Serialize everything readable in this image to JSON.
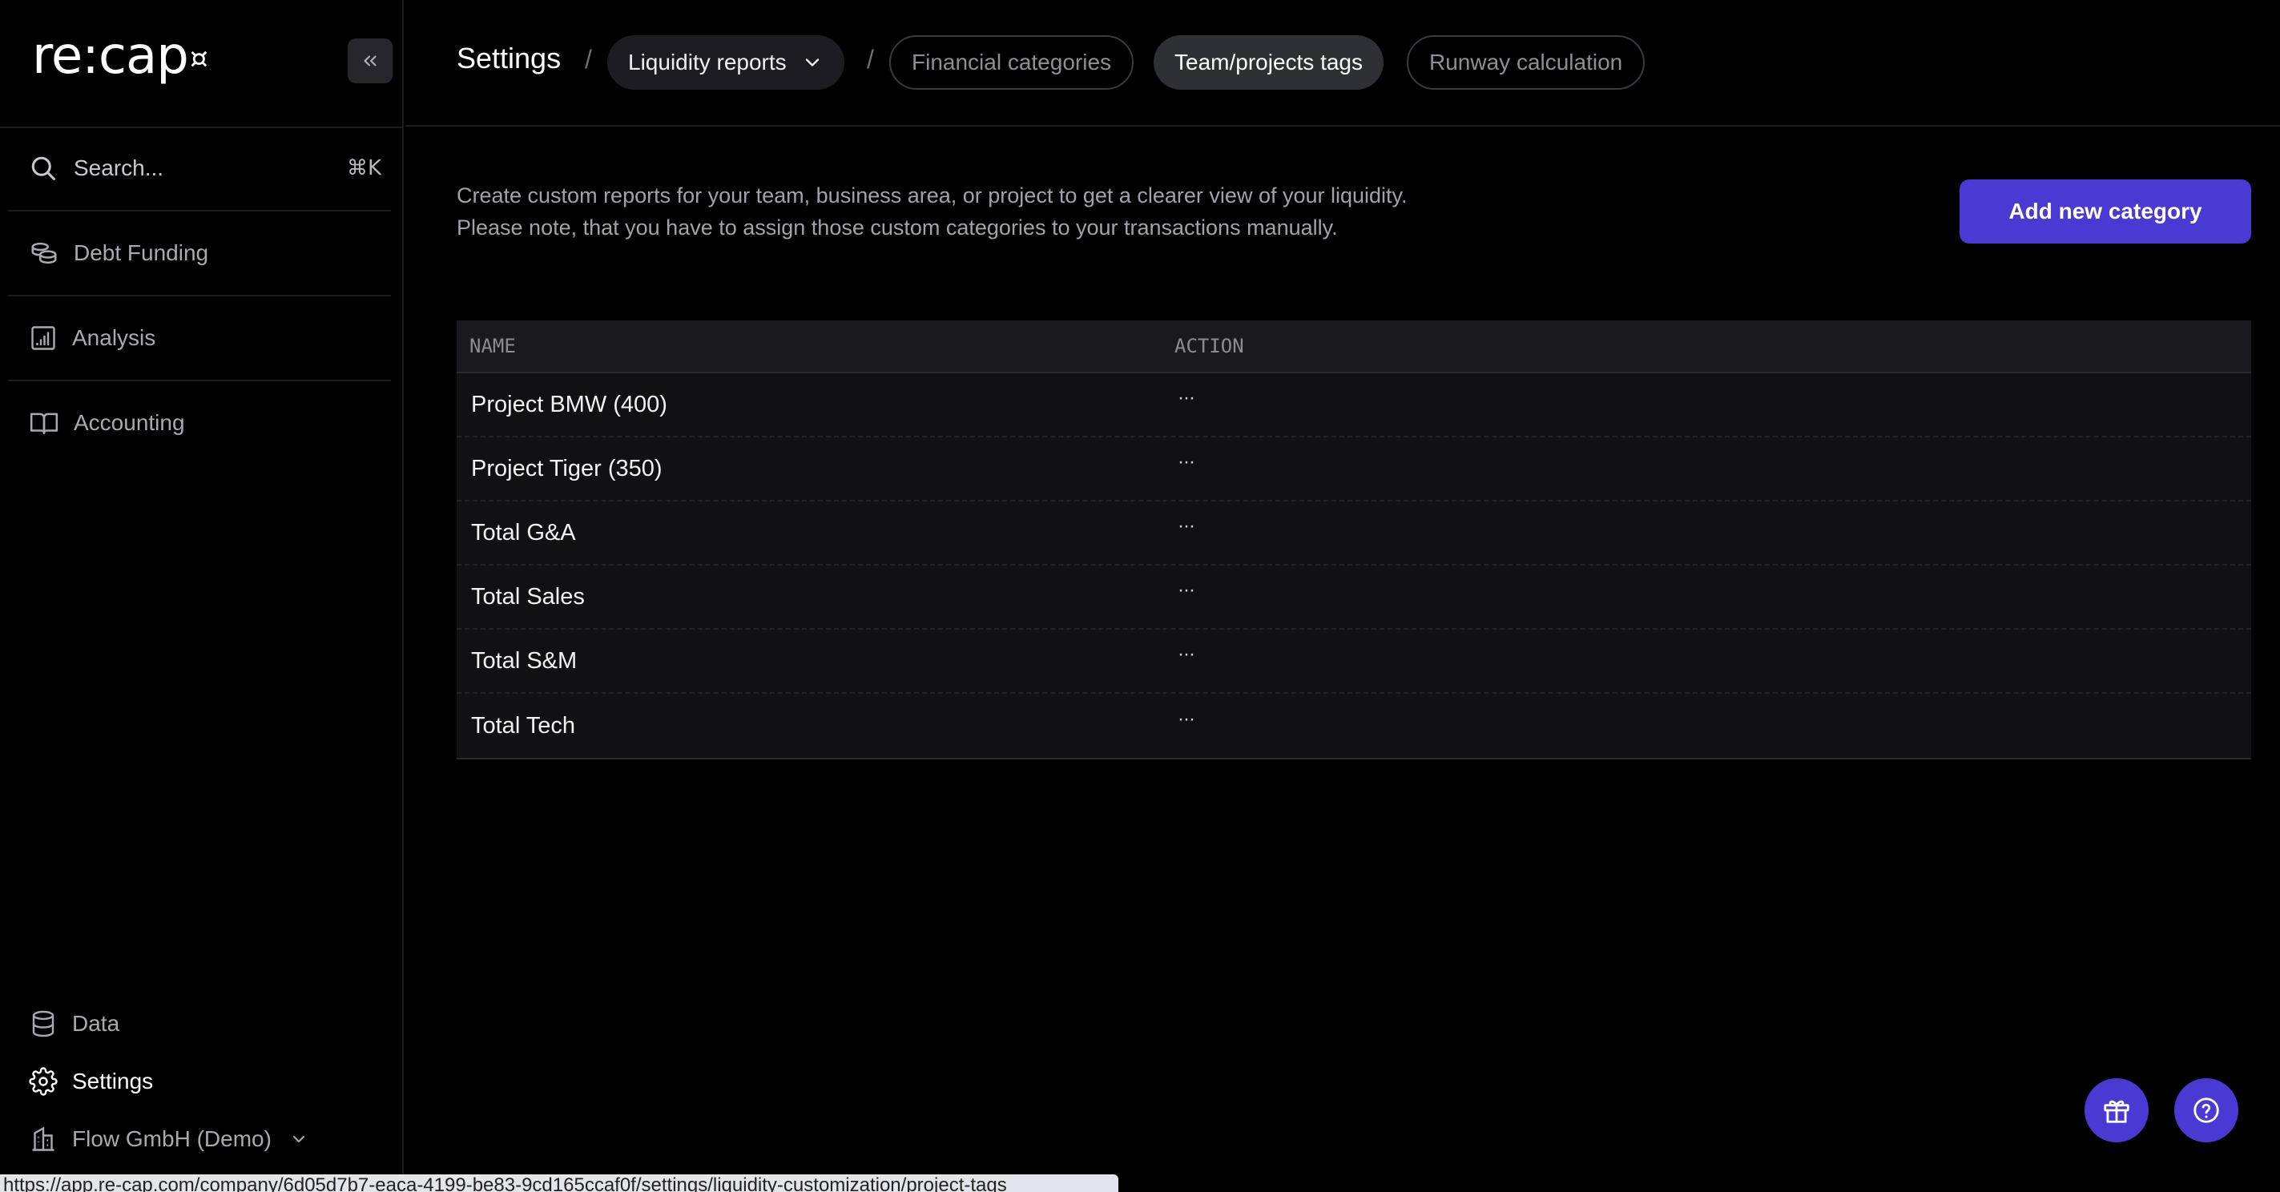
{
  "app": {
    "logo_text": "re:cap",
    "logo_mark": "¤"
  },
  "sidebar": {
    "search": {
      "placeholder": "Search...",
      "shortcut": "⌘K"
    },
    "top_items": [
      {
        "label": "Debt Funding",
        "icon": "coins-icon"
      },
      {
        "label": "Analysis",
        "icon": "chart-grid-icon"
      },
      {
        "label": "Accounting",
        "icon": "book-icon"
      }
    ],
    "bottom_items": [
      {
        "label": "Data",
        "icon": "database-icon"
      },
      {
        "label": "Settings",
        "icon": "gear-icon",
        "active": true
      }
    ],
    "company": {
      "label": "Flow GmbH (Demo)",
      "icon": "building-icon"
    }
  },
  "header": {
    "title": "Settings",
    "dropdown_label": "Liquidity reports",
    "tabs": [
      {
        "label": "Financial categories",
        "selected": false
      },
      {
        "label": "Team/projects tags",
        "selected": true
      },
      {
        "label": "Runway calculation",
        "selected": false
      }
    ]
  },
  "main": {
    "description_line1": "Create custom reports for your team, business area, or project to get a clearer view of your liquidity.",
    "description_line2": "Please note, that you have to assign those custom categories to your transactions manually.",
    "add_button_label": "Add new category",
    "table": {
      "columns": [
        "NAME",
        "ACTION"
      ],
      "rows": [
        {
          "name": "Project BMW (400)",
          "action": "···"
        },
        {
          "name": "Project Tiger (350)",
          "action": "···"
        },
        {
          "name": "Total G&A",
          "action": "···"
        },
        {
          "name": "Total Sales",
          "action": "···"
        },
        {
          "name": "Total S&M",
          "action": "···"
        },
        {
          "name": "Total Tech",
          "action": "···"
        }
      ]
    }
  },
  "floating": {
    "gift_icon": "gift-icon",
    "help_icon": "help-icon"
  },
  "status_bar": {
    "url": "https://app.re-cap.com/company/6d05d7b7-eaca-4199-be83-9cd165ccaf0f/settings/liquidity-customization/project-tags"
  },
  "colors": {
    "accent": "#4a3ad4",
    "background": "#000000",
    "table_bg": "#111114"
  }
}
